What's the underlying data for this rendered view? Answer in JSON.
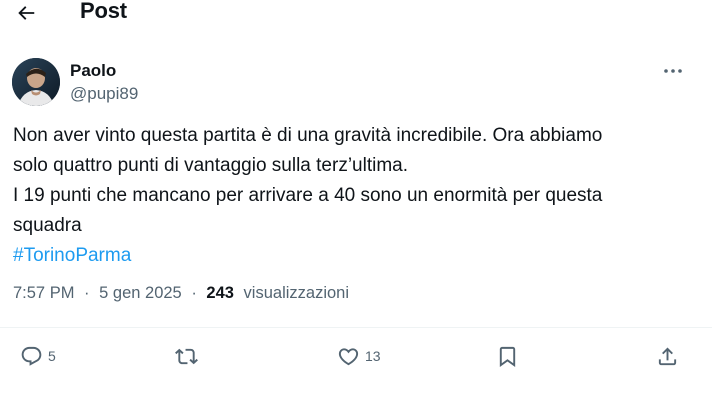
{
  "header": {
    "back_icon": "arrow-left-icon",
    "title": "Post"
  },
  "author": {
    "name": "Paolo",
    "handle": "@pupi89"
  },
  "post": {
    "lines": [
      "Non aver vinto questa partita è di una gravità incredibile. Ora abbiamo",
      "solo quattro punti di vantaggio sulla terz’ultima.",
      "I 19 punti che mancano per arrivare a 40 sono  un enormità per questa",
      "squadra"
    ],
    "hashtag": "#TorinoParma"
  },
  "meta": {
    "time": "7:57 PM",
    "separator1": "·",
    "date": "5 gen 2025",
    "separator2": "·",
    "views_count": "243",
    "views_label": "visualizzazioni"
  },
  "actions": {
    "replies": "5",
    "reposts": "",
    "likes": "13"
  },
  "colors": {
    "text": "#0f1419",
    "secondary": "#536471",
    "link": "#1d9bf0",
    "divider": "#eff3f4"
  }
}
